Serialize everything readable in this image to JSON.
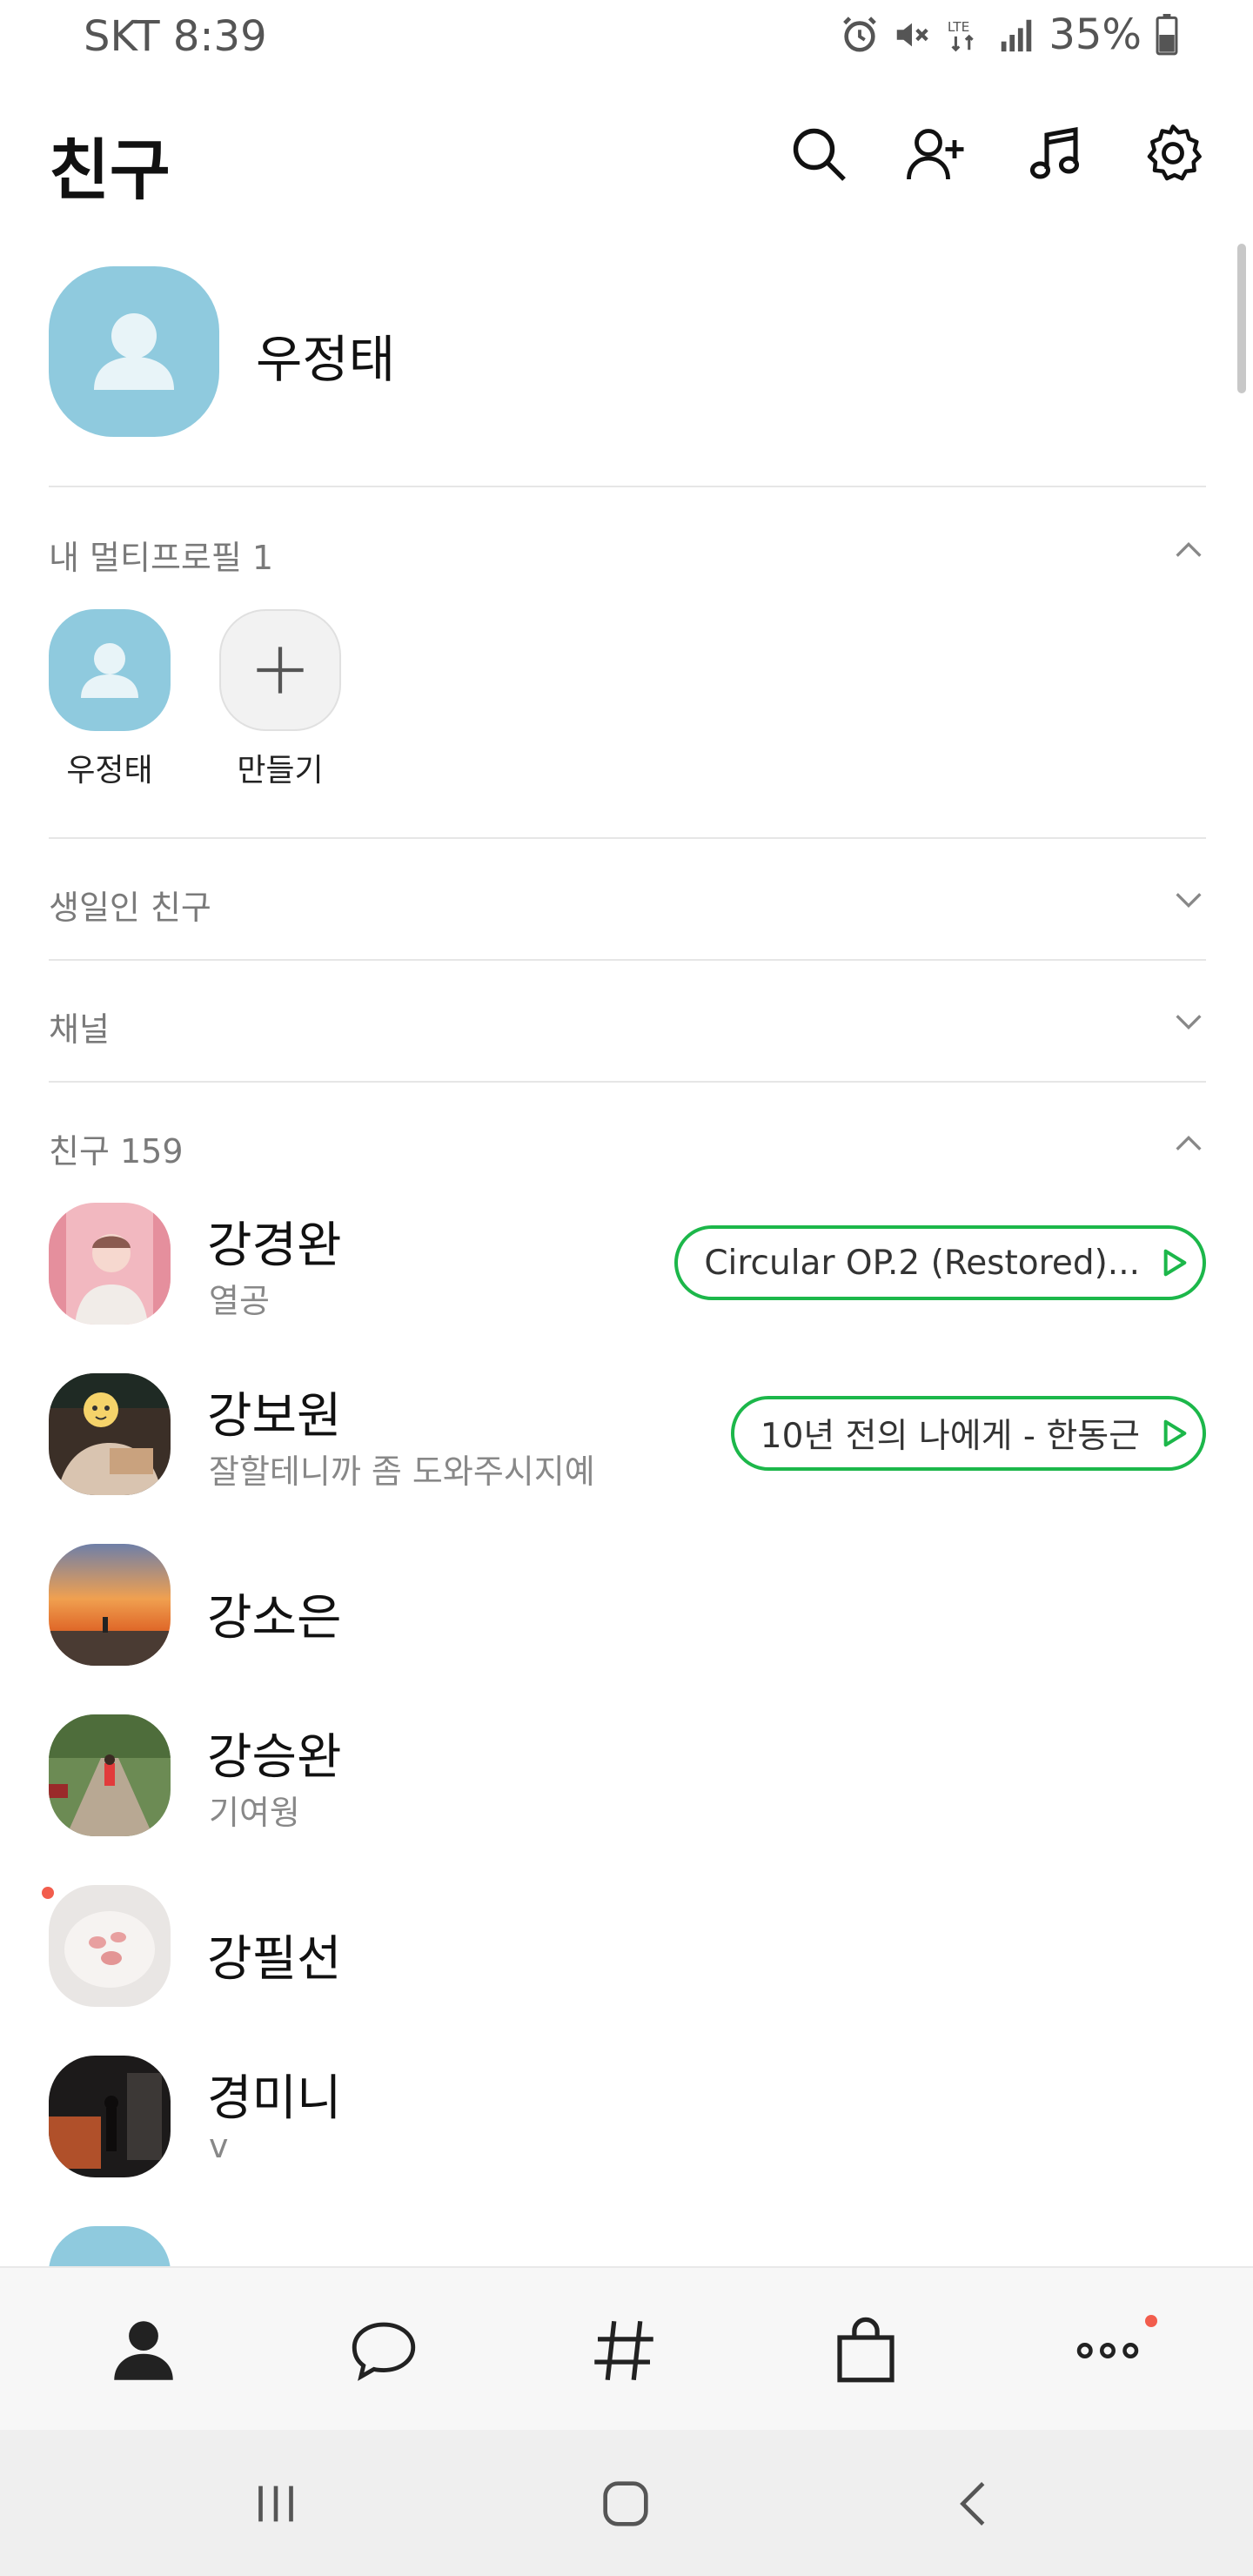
{
  "status_bar": {
    "carrier": "SKT",
    "time": "8:39",
    "network": "LTE",
    "battery": "35%",
    "icons": [
      "alarm-icon",
      "mute-icon",
      "lte-icon",
      "signal-icon",
      "battery-icon"
    ]
  },
  "header": {
    "title": "친구",
    "actions": [
      "search-icon",
      "add-friend-icon",
      "music-icon",
      "settings-icon"
    ]
  },
  "my_profile": {
    "name": "우정태"
  },
  "multi_profile": {
    "label": "내 멀티프로필 1",
    "items": [
      {
        "label": "우정태"
      },
      {
        "label": "만들기"
      }
    ]
  },
  "sections": {
    "birthday": "생일인 친구",
    "channel": "채널",
    "friends": "친구 159"
  },
  "friends": [
    {
      "name": "강경완",
      "status": "열공",
      "music": "Circular OP.2 (Restored)..."
    },
    {
      "name": "강보원",
      "status": "잘할테니까 좀 도와주시지예",
      "music": "10년 전의 나에게 - 한동근"
    },
    {
      "name": "강소은",
      "status": "",
      "music": ""
    },
    {
      "name": "강승완",
      "status": "기여웡",
      "music": ""
    },
    {
      "name": "강필선",
      "status": "",
      "music": ""
    },
    {
      "name": "경미니",
      "status": "v",
      "music": ""
    }
  ],
  "colors": {
    "accent_green": "#1cb74a",
    "default_avatar": "#8fcade",
    "notification_dot": "#f25d4d"
  },
  "bottom_nav": [
    "friends-tab-icon",
    "chat-tab-icon",
    "hashtag-tab-icon",
    "shopping-tab-icon",
    "more-tab-icon"
  ],
  "system_nav": [
    "recent-apps-icon",
    "home-icon",
    "back-icon"
  ]
}
